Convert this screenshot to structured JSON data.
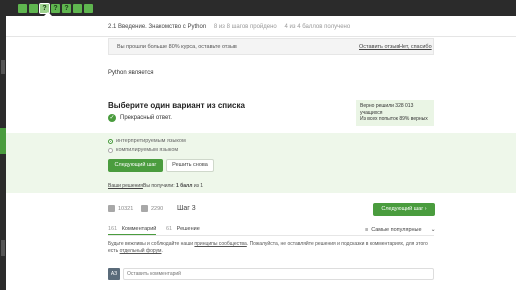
{
  "topbar": {
    "steps": [
      "",
      "",
      "?",
      "?",
      "?",
      "",
      ""
    ],
    "current_step_index": 2
  },
  "lesson": {
    "title": "2.1 Введение. Знакомство с Python",
    "steps_done": "8 из 8 шагов пройдено",
    "points": "4 из 4 баллов  получено"
  },
  "banner": {
    "text": "Вы прошли больше 80% курса, оставьте отзыв",
    "leave_review": "Оставить отзыв",
    "no_thanks": "Нет, спасибо"
  },
  "question": "Python является",
  "quiz": {
    "title": "Выберите один вариант из списка",
    "feedback": "Прекрасный ответ.",
    "stats_line1": "Верно решили 328 013",
    "stats_line2": "учащихся",
    "stats_line3": "Из всех попыток 89% верных",
    "options": [
      "интерпретируемым языком",
      "компилируемым языком"
    ],
    "selected_option": 0,
    "next_button": "Следующий шаг",
    "retry_button": "Решить снова",
    "your_solutions": "Ваши решения",
    "score_prefix": "Вы получили:",
    "score_value": "1 балл",
    "score_suffix": "из 1"
  },
  "footer": {
    "likes": "10321",
    "dislikes": "2290",
    "step_label": "Шаг 3",
    "next_button": "Следующий шаг",
    "tabs": [
      {
        "count": "161",
        "label": "Комментарий"
      },
      {
        "count": "61",
        "label": "Решение"
      }
    ],
    "sort_label": "Самые популярные",
    "notice_part1": "Будьте вежливы и соблюдайте наши ",
    "notice_link": "принципы сообщества",
    "notice_part2": ". Пожалуйста, не оставляйте решения и подсказки в комментариях, для этого есть ",
    "notice_link2": "отдельный форум",
    "notice_part3": ".",
    "avatar_initials": "АЗ",
    "comment_placeholder": "Оставить комментарий"
  },
  "colors": {
    "accent": "#4a9c3e",
    "answer_panel": "#eef7ea",
    "topbar": "#2b2b2b"
  }
}
